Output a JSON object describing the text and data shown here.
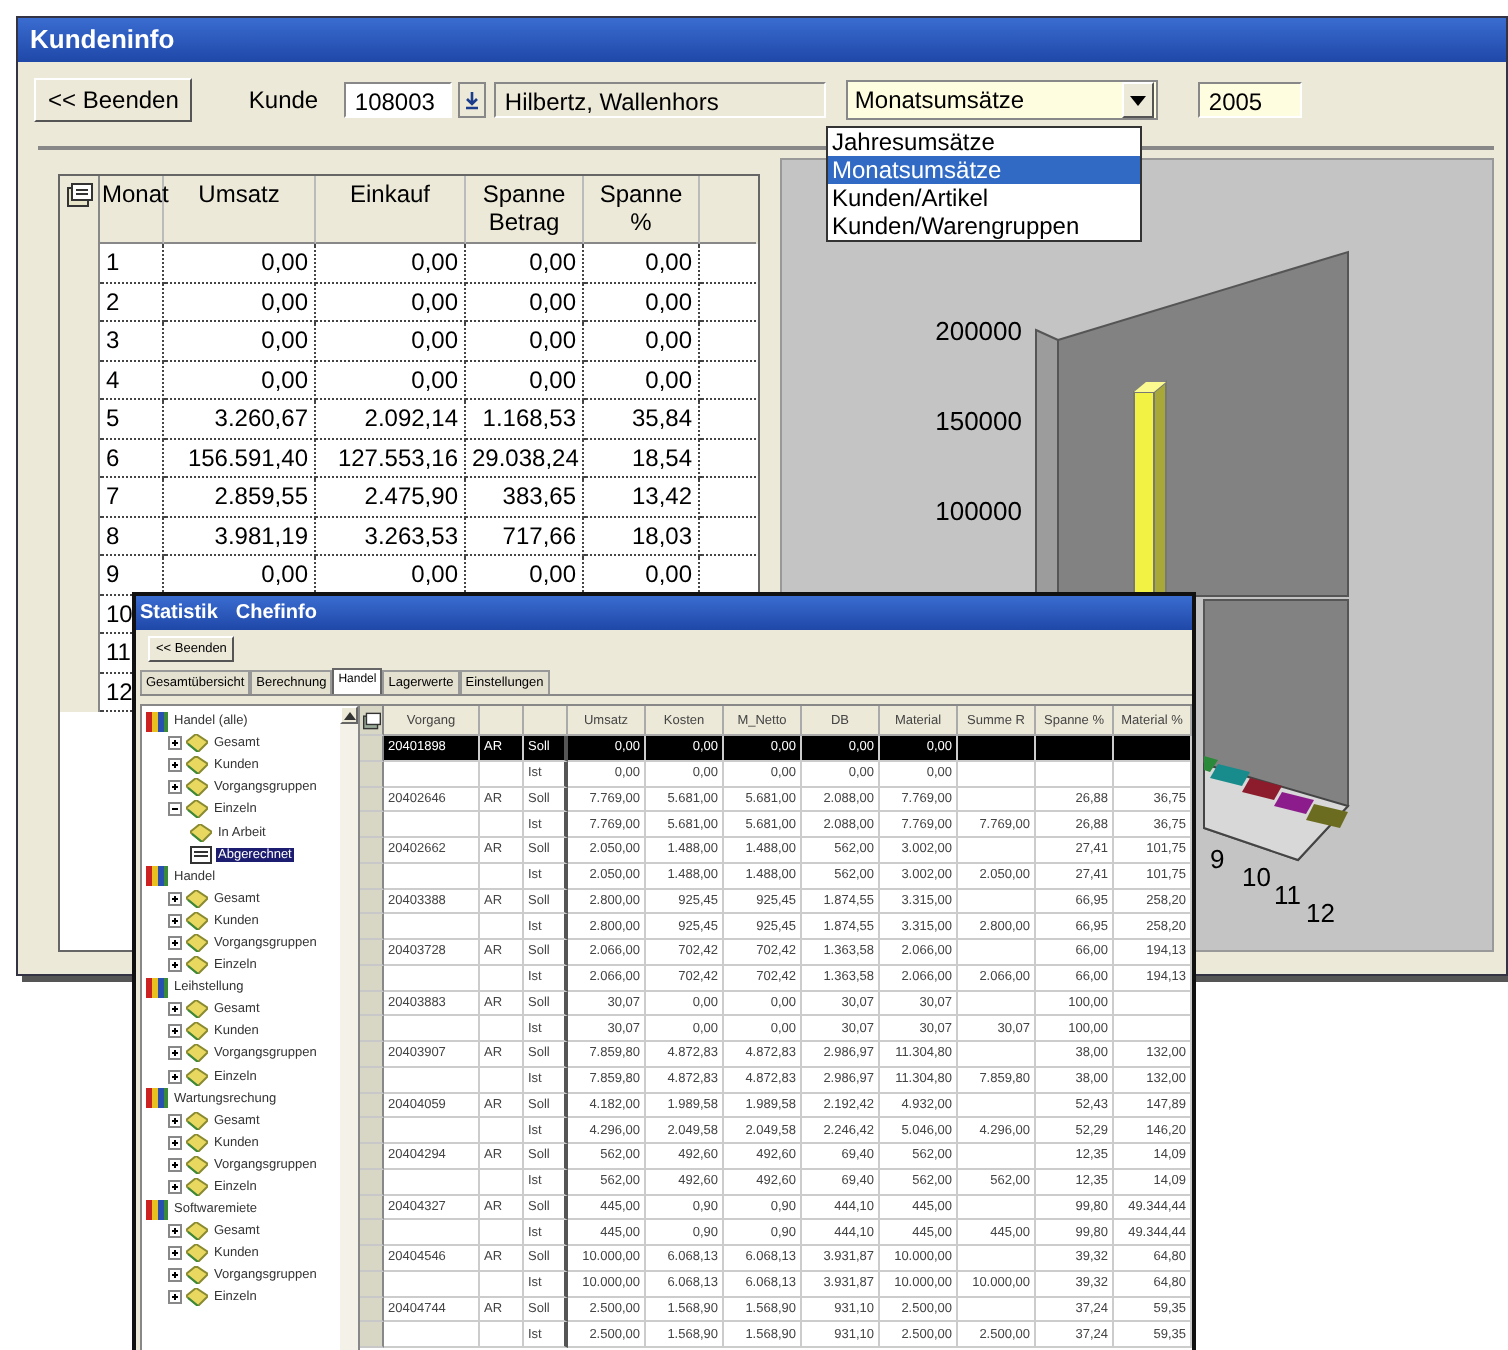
{
  "kundeninfo": {
    "title": "Kundeninfo",
    "back_button": "<< Beenden",
    "customer_label": "Kunde",
    "customer_number": "108003",
    "customer_name": "Hilbertz, Wallenhors",
    "view_select": {
      "value": "Monatsumsätze",
      "options": [
        {
          "label": "Jahresumsätze",
          "selected": false
        },
        {
          "label": "Monatsumsätze",
          "selected": true
        },
        {
          "label": "Kunden/Artikel",
          "selected": false
        },
        {
          "label": "Kunden/Warengruppen",
          "selected": false
        }
      ]
    },
    "year": "2005",
    "table": {
      "headers": {
        "monat": "Monat",
        "umsatz": "Umsatz",
        "einkauf": "Einkauf",
        "spanne_betrag": "Spanne Betrag",
        "spanne_pct": "Spanne %"
      },
      "rows": [
        {
          "monat": "1",
          "umsatz": "0,00",
          "einkauf": "0,00",
          "spanne_betrag": "0,00",
          "spanne_pct": "0,00"
        },
        {
          "monat": "2",
          "umsatz": "0,00",
          "einkauf": "0,00",
          "spanne_betrag": "0,00",
          "spanne_pct": "0,00"
        },
        {
          "monat": "3",
          "umsatz": "0,00",
          "einkauf": "0,00",
          "spanne_betrag": "0,00",
          "spanne_pct": "0,00"
        },
        {
          "monat": "4",
          "umsatz": "0,00",
          "einkauf": "0,00",
          "spanne_betrag": "0,00",
          "spanne_pct": "0,00"
        },
        {
          "monat": "5",
          "umsatz": "3.260,67",
          "einkauf": "2.092,14",
          "spanne_betrag": "1.168,53",
          "spanne_pct": "35,84"
        },
        {
          "monat": "6",
          "umsatz": "156.591,40",
          "einkauf": "127.553,16",
          "spanne_betrag": "29.038,24",
          "spanne_pct": "18,54"
        },
        {
          "monat": "7",
          "umsatz": "2.859,55",
          "einkauf": "2.475,90",
          "spanne_betrag": "383,65",
          "spanne_pct": "13,42"
        },
        {
          "monat": "8",
          "umsatz": "3.981,19",
          "einkauf": "3.263,53",
          "spanne_betrag": "717,66",
          "spanne_pct": "18,03"
        },
        {
          "monat": "9",
          "umsatz": "0,00",
          "einkauf": "0,00",
          "spanne_betrag": "0,00",
          "spanne_pct": "0,00"
        },
        {
          "monat": "10"
        },
        {
          "monat": "11"
        },
        {
          "monat": "12"
        }
      ]
    },
    "chart": {
      "y_labels": [
        "200000",
        "150000",
        "100000"
      ],
      "x_labels": [
        "9",
        "10",
        "11",
        "12"
      ]
    }
  },
  "statistik": {
    "title": [
      "Statistik",
      "Chefinfo"
    ],
    "back_button": "<< Beenden",
    "tabs": [
      {
        "label": "Gesamtübersicht",
        "selected": false
      },
      {
        "label": "Berechnung",
        "selected": false
      },
      {
        "label": "Handel",
        "selected": true
      },
      {
        "label": "Lagerwerte",
        "selected": false
      },
      {
        "label": "Einstellungen",
        "selected": false
      }
    ],
    "tree": [
      {
        "label": "Handel (alle)",
        "kind": "book",
        "selected": false,
        "children": [
          {
            "label": "Gesamt",
            "kind": "folder",
            "expanded": false,
            "selected": false
          },
          {
            "label": "Kunden",
            "kind": "folder",
            "expanded": false,
            "selected": false
          },
          {
            "label": "Vorgangsgruppen",
            "kind": "folder",
            "expanded": false,
            "selected": false
          },
          {
            "label": "Einzeln",
            "kind": "folder",
            "expanded": true,
            "selected": false,
            "children": [
              {
                "label": "In Arbeit",
                "kind": "folder",
                "selected": false
              },
              {
                "label": "Abgerechnet",
                "kind": "page",
                "selected": true
              }
            ]
          }
        ]
      },
      {
        "label": "Handel",
        "kind": "book",
        "selected": false,
        "children": [
          {
            "label": "Gesamt",
            "kind": "folder",
            "expanded": false,
            "selected": false
          },
          {
            "label": "Kunden",
            "kind": "folder",
            "expanded": false,
            "selected": false
          },
          {
            "label": "Vorgangsgruppen",
            "kind": "folder",
            "expanded": false,
            "selected": false
          },
          {
            "label": "Einzeln",
            "kind": "folder",
            "expanded": false,
            "selected": false
          }
        ]
      },
      {
        "label": "Leihstellung",
        "kind": "book",
        "selected": false,
        "children": [
          {
            "label": "Gesamt",
            "kind": "folder",
            "expanded": false,
            "selected": false
          },
          {
            "label": "Kunden",
            "kind": "folder",
            "expanded": false,
            "selected": false
          },
          {
            "label": "Vorgangsgruppen",
            "kind": "folder",
            "expanded": false,
            "selected": false
          },
          {
            "label": "Einzeln",
            "kind": "folder",
            "expanded": false,
            "selected": false
          }
        ]
      },
      {
        "label": "Wartungsrechung",
        "kind": "book",
        "selected": false,
        "children": [
          {
            "label": "Gesamt",
            "kind": "folder",
            "expanded": false,
            "selected": false
          },
          {
            "label": "Kunden",
            "kind": "folder",
            "expanded": false,
            "selected": false
          },
          {
            "label": "Vorgangsgruppen",
            "kind": "folder",
            "expanded": false,
            "selected": false
          },
          {
            "label": "Einzeln",
            "kind": "folder",
            "expanded": false,
            "selected": false
          }
        ]
      },
      {
        "label": "Softwaremiete",
        "kind": "book",
        "selected": false,
        "children": [
          {
            "label": "Gesamt",
            "kind": "folder",
            "expanded": false,
            "selected": false
          },
          {
            "label": "Kunden",
            "kind": "folder",
            "expanded": false,
            "selected": false
          },
          {
            "label": "Vorgangsgruppen",
            "kind": "folder",
            "expanded": false,
            "selected": false
          },
          {
            "label": "Einzeln",
            "kind": "folder",
            "expanded": false,
            "selected": false
          }
        ]
      }
    ],
    "table": {
      "headers": {
        "vorgang": "Vorgang",
        "umsatz": "Umsatz",
        "kosten": "Kosten",
        "m_netto": "M_Netto",
        "db": "DB",
        "material": "Material",
        "summe_r": "Summe R",
        "spanne_pct": "Spanne %",
        "material_pct": "Material %"
      },
      "rows": [
        {
          "selected": true,
          "vorgang": "20401898",
          "column_2": "AR",
          "column_3": "Soll",
          "umsatz": "0,00",
          "kosten": "0,00",
          "m_netto": "0,00",
          "db": "0,00",
          "material": "0,00"
        },
        {
          "selected": false,
          "column_3": "Ist",
          "umsatz": "0,00",
          "kosten": "0,00",
          "m_netto": "0,00",
          "db": "0,00",
          "material": "0,00"
        },
        {
          "selected": false,
          "vorgang": "20402646",
          "column_2": "AR",
          "column_3": "Soll",
          "umsatz": "7.769,00",
          "kosten": "5.681,00",
          "m_netto": "5.681,00",
          "db": "2.088,00",
          "material": "7.769,00",
          "spanne_pct": "26,88",
          "material_pct": "36,75"
        },
        {
          "selected": false,
          "column_3": "Ist",
          "umsatz": "7.769,00",
          "kosten": "5.681,00",
          "m_netto": "5.681,00",
          "db": "2.088,00",
          "material": "7.769,00",
          "summe_r": "7.769,00",
          "spanne_pct": "26,88",
          "material_pct": "36,75"
        },
        {
          "selected": false,
          "vorgang": "20402662",
          "column_2": "AR",
          "column_3": "Soll",
          "umsatz": "2.050,00",
          "kosten": "1.488,00",
          "m_netto": "1.488,00",
          "db": "562,00",
          "material": "3.002,00",
          "spanne_pct": "27,41",
          "material_pct": "101,75"
        },
        {
          "selected": false,
          "column_3": "Ist",
          "umsatz": "2.050,00",
          "kosten": "1.488,00",
          "m_netto": "1.488,00",
          "db": "562,00",
          "material": "3.002,00",
          "summe_r": "2.050,00",
          "spanne_pct": "27,41",
          "material_pct": "101,75"
        },
        {
          "selected": false,
          "vorgang": "20403388",
          "column_2": "AR",
          "column_3": "Soll",
          "umsatz": "2.800,00",
          "kosten": "925,45",
          "m_netto": "925,45",
          "db": "1.874,55",
          "material": "3.315,00",
          "spanne_pct": "66,95",
          "material_pct": "258,20"
        },
        {
          "selected": false,
          "column_3": "Ist",
          "umsatz": "2.800,00",
          "kosten": "925,45",
          "m_netto": "925,45",
          "db": "1.874,55",
          "material": "3.315,00",
          "summe_r": "2.800,00",
          "spanne_pct": "66,95",
          "material_pct": "258,20"
        },
        {
          "selected": false,
          "vorgang": "20403728",
          "column_2": "AR",
          "column_3": "Soll",
          "umsatz": "2.066,00",
          "kosten": "702,42",
          "m_netto": "702,42",
          "db": "1.363,58",
          "material": "2.066,00",
          "spanne_pct": "66,00",
          "material_pct": "194,13"
        },
        {
          "selected": false,
          "column_3": "Ist",
          "umsatz": "2.066,00",
          "kosten": "702,42",
          "m_netto": "702,42",
          "db": "1.363,58",
          "material": "2.066,00",
          "summe_r": "2.066,00",
          "spanne_pct": "66,00",
          "material_pct": "194,13"
        },
        {
          "selected": false,
          "vorgang": "20403883",
          "column_2": "AR",
          "column_3": "Soll",
          "umsatz": "30,07",
          "kosten": "0,00",
          "m_netto": "0,00",
          "db": "30,07",
          "material": "30,07",
          "spanne_pct": "100,00"
        },
        {
          "selected": false,
          "column_3": "Ist",
          "umsatz": "30,07",
          "kosten": "0,00",
          "m_netto": "0,00",
          "db": "30,07",
          "material": "30,07",
          "summe_r": "30,07",
          "spanne_pct": "100,00"
        },
        {
          "selected": false,
          "vorgang": "20403907",
          "column_2": "AR",
          "column_3": "Soll",
          "umsatz": "7.859,80",
          "kosten": "4.872,83",
          "m_netto": "4.872,83",
          "db": "2.986,97",
          "material": "11.304,80",
          "spanne_pct": "38,00",
          "material_pct": "132,00"
        },
        {
          "selected": false,
          "column_3": "Ist",
          "umsatz": "7.859,80",
          "kosten": "4.872,83",
          "m_netto": "4.872,83",
          "db": "2.986,97",
          "material": "11.304,80",
          "summe_r": "7.859,80",
          "spanne_pct": "38,00",
          "material_pct": "132,00"
        },
        {
          "selected": false,
          "vorgang": "20404059",
          "column_2": "AR",
          "column_3": "Soll",
          "umsatz": "4.182,00",
          "kosten": "1.989,58",
          "m_netto": "1.989,58",
          "db": "2.192,42",
          "material": "4.932,00",
          "spanne_pct": "52,43",
          "material_pct": "147,89"
        },
        {
          "selected": false,
          "column_3": "Ist",
          "umsatz": "4.296,00",
          "kosten": "2.049,58",
          "m_netto": "2.049,58",
          "db": "2.246,42",
          "material": "5.046,00",
          "summe_r": "4.296,00",
          "spanne_pct": "52,29",
          "material_pct": "146,20"
        },
        {
          "selected": false,
          "vorgang": "20404294",
          "column_2": "AR",
          "column_3": "Soll",
          "umsatz": "562,00",
          "kosten": "492,60",
          "m_netto": "492,60",
          "db": "69,40",
          "material": "562,00",
          "spanne_pct": "12,35",
          "material_pct": "14,09"
        },
        {
          "selected": false,
          "column_3": "Ist",
          "umsatz": "562,00",
          "kosten": "492,60",
          "m_netto": "492,60",
          "db": "69,40",
          "material": "562,00",
          "summe_r": "562,00",
          "spanne_pct": "12,35",
          "material_pct": "14,09"
        },
        {
          "selected": false,
          "vorgang": "20404327",
          "column_2": "AR",
          "column_3": "Soll",
          "umsatz": "445,00",
          "kosten": "0,90",
          "m_netto": "0,90",
          "db": "444,10",
          "material": "445,00",
          "spanne_pct": "99,80",
          "material_pct": "49.344,44"
        },
        {
          "selected": false,
          "column_3": "Ist",
          "umsatz": "445,00",
          "kosten": "0,90",
          "m_netto": "0,90",
          "db": "444,10",
          "material": "445,00",
          "summe_r": "445,00",
          "spanne_pct": "99,80",
          "material_pct": "49.344,44"
        },
        {
          "selected": false,
          "vorgang": "20404546",
          "column_2": "AR",
          "column_3": "Soll",
          "umsatz": "10.000,00",
          "kosten": "6.068,13",
          "m_netto": "6.068,13",
          "db": "3.931,87",
          "material": "10.000,00",
          "spanne_pct": "39,32",
          "material_pct": "64,80"
        },
        {
          "selected": false,
          "column_3": "Ist",
          "umsatz": "10.000,00",
          "kosten": "6.068,13",
          "m_netto": "6.068,13",
          "db": "3.931,87",
          "material": "10.000,00",
          "summe_r": "10.000,00",
          "spanne_pct": "39,32",
          "material_pct": "64,80"
        },
        {
          "selected": false,
          "vorgang": "20404744",
          "column_2": "AR",
          "column_3": "Soll",
          "umsatz": "2.500,00",
          "kosten": "1.568,90",
          "m_netto": "1.568,90",
          "db": "931,10",
          "material": "2.500,00",
          "spanne_pct": "37,24",
          "material_pct": "59,35"
        },
        {
          "selected": false,
          "column_3": "Ist",
          "umsatz": "2.500,00",
          "kosten": "1.568,90",
          "m_netto": "1.568,90",
          "db": "931,10",
          "material": "2.500,00",
          "summe_r": "2.500,00",
          "spanne_pct": "37,24",
          "material_pct": "59,35"
        }
      ]
    }
  }
}
